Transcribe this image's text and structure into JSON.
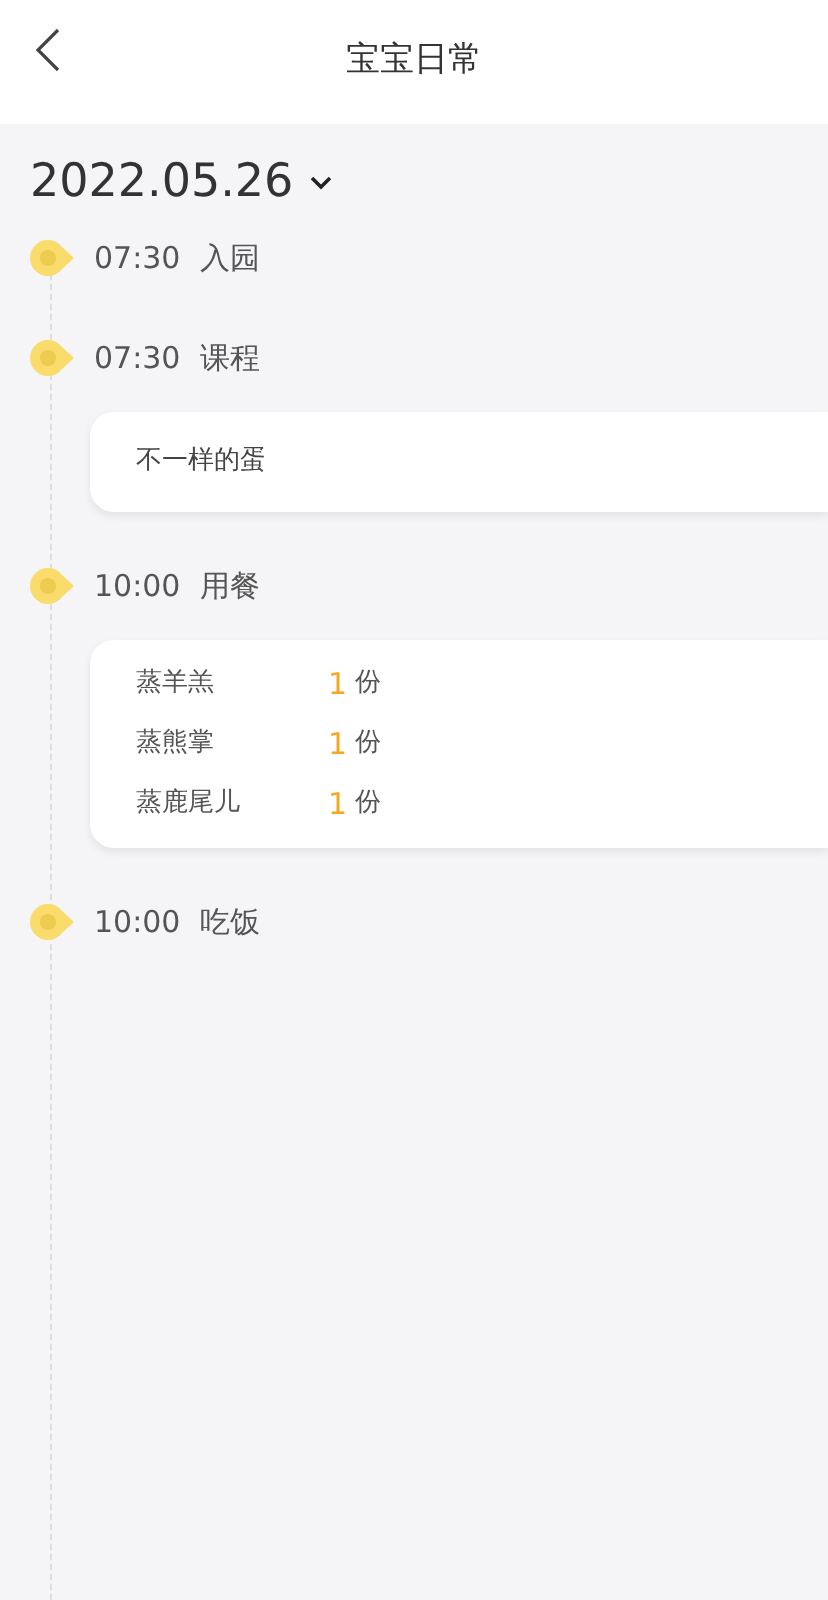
{
  "header": {
    "title": "宝宝日常"
  },
  "date": "2022.05.26",
  "events": [
    {
      "time": "07:30",
      "title": "入园"
    },
    {
      "time": "07:30",
      "title": "课程",
      "card": {
        "kind": "note",
        "text": "不一样的蛋"
      }
    },
    {
      "time": "10:00",
      "title": "用餐",
      "card": {
        "kind": "meals",
        "items": [
          {
            "name": "蒸羊羔",
            "qty": "1",
            "unit": "份"
          },
          {
            "name": "蒸熊掌",
            "qty": "1",
            "unit": "份"
          },
          {
            "name": "蒸鹿尾儿",
            "qty": "1",
            "unit": "份"
          }
        ]
      }
    },
    {
      "time": "10:00",
      "title": "吃饭"
    }
  ]
}
